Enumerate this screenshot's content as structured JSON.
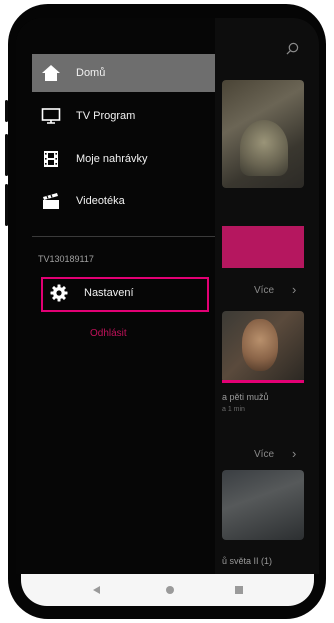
{
  "drawer": {
    "items": [
      {
        "label": "Domů",
        "icon": "home-icon"
      },
      {
        "label": "TV Program",
        "icon": "tv-icon"
      },
      {
        "label": "Moje nahrávky",
        "icon": "film-icon"
      },
      {
        "label": "Videotéka",
        "icon": "clapperboard-icon"
      }
    ],
    "device_id": "TV130189117",
    "settings_label": "Nastavení",
    "logout_label": "Odhlásit"
  },
  "background": {
    "more_label_1": "Více",
    "more_label_2": "Více",
    "title_1": "a pěti mužů",
    "meta_1": "a 1 min",
    "title_2": "ů světa II (1)"
  },
  "colors": {
    "accent": "#e20074",
    "active_item": "#6e6e6e",
    "logout": "#c0125a"
  }
}
